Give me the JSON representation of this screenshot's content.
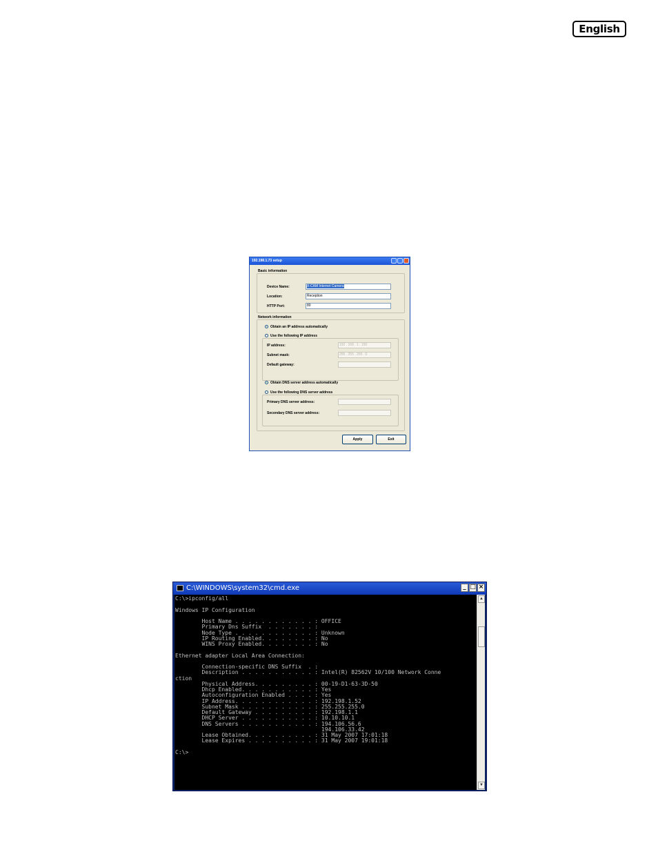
{
  "page": {
    "language_label": "English"
  },
  "setup_dialog": {
    "title": "192.198.1.73 setup",
    "basic_group_title": "Basic information",
    "device_name_label": "Device Name:",
    "device_name_value": "X-CAM Internet Camera",
    "location_label": "Location:",
    "location_value": "Reception",
    "http_port_label": "HTTP Port:",
    "http_port_value": "80",
    "network_group_title": "Network information",
    "obtain_ip_auto_label": "Obtain an IP address automatically",
    "use_following_ip_label": "Use the following IP address",
    "ip_address_label": "IP address:",
    "ip_address_value": "192 . 168 .  1  . 150",
    "subnet_mask_label": "Subnet mask:",
    "subnet_mask_value": "255 . 255 . 255 .  0",
    "default_gateway_label": "Default gateway:",
    "default_gateway_value": "",
    "obtain_dns_auto_label": "Obtain DNS server address automatically",
    "use_following_dns_label": "Use the following DNS server address",
    "primary_dns_label": "Primary DNS server address:",
    "primary_dns_value": "",
    "secondary_dns_label": "Secondary DNS server address:",
    "secondary_dns_value": "",
    "apply_label": "Apply",
    "exit_label": "Exit",
    "selected_ip_mode": "automatic",
    "selected_dns_mode": "automatic"
  },
  "cmd_window": {
    "title": "C:\\WINDOWS\\system32\\cmd.exe",
    "minimize_glyph": "_",
    "maximize_glyph": "□",
    "close_glyph": "×",
    "console_text": "C:\\>ipconfig/all\n\nWindows IP Configuration\n\n        Host Name . . . . . . . . . . . . : OFFICE\n        Primary Dns Suffix  . . . . . . . :\n        Node Type . . . . . . . . . . . . : Unknown\n        IP Routing Enabled. . . . . . . . : No\n        WINS Proxy Enabled. . . . . . . . : No\n\nEthernet adapter Local Area Connection:\n\n        Connection-specific DNS Suffix  . :\n        Description . . . . . . . . . . . : Intel(R) 82562V 10/100 Network Conne\nction\n        Physical Address. . . . . . . . . : 00-19-D1-63-3D-50\n        Dhcp Enabled. . . . . . . . . . . : Yes\n        Autoconfiguration Enabled . . . . : Yes\n        IP Address. . . . . . . . . . . . : 192.198.1.52\n        Subnet Mask . . . . . . . . . . . : 255.255.255.0\n        Default Gateway . . . . . . . . . : 192.198.1.1\n        DHCP Server . . . . . . . . . . . : 10.10.10.1\n        DNS Servers . . . . . . . . . . . : 194.106.56.6\n                                            194.106.33.42\n        Lease Obtained. . . . . . . . . . : 31 May 2007 17:01:18\n        Lease Expires . . . . . . . . . . : 31 May 2007 19:01:18\n\nC:\\>"
  }
}
